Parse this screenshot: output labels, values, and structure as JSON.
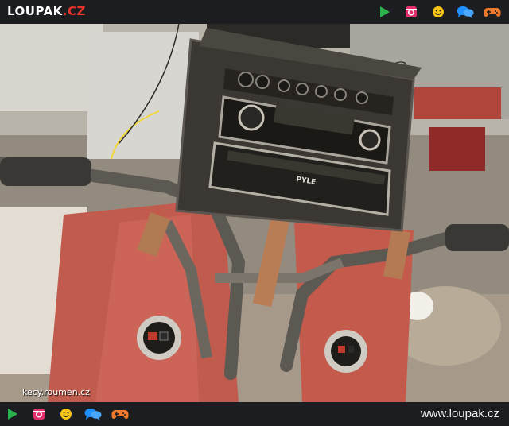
{
  "header": {
    "logo_main": "LOUPAK",
    "logo_tld": ".CZ"
  },
  "nav_icons": [
    "play-icon",
    "instagram-icon",
    "smiley-icon",
    "chat-icon",
    "gamepad-icon"
  ],
  "photo": {
    "watermark": "kecy.roumen.cz",
    "radio_brand": "PYLE"
  },
  "footer": {
    "site": "www.loupak.cz"
  },
  "colors": {
    "bar_bg": "#1b1d21",
    "logo_accent": "#e8332a",
    "play": "#2bb24c",
    "instagram": "#e1306c",
    "smiley": "#f5c518",
    "chat": "#1e90ff",
    "gamepad": "#f07a2b"
  }
}
